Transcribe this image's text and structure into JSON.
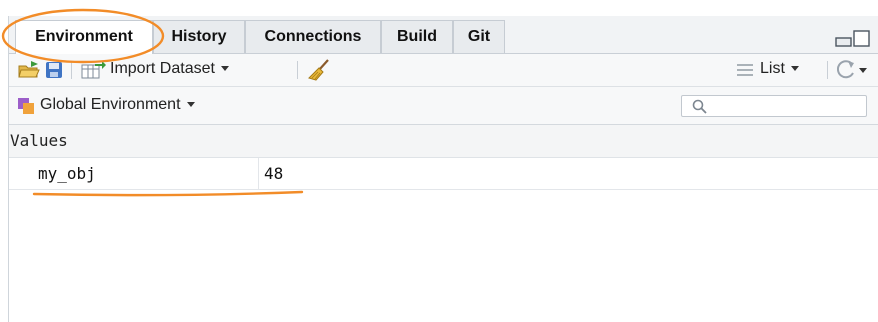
{
  "tabs": [
    {
      "label": "Environment",
      "active": true
    },
    {
      "label": "History",
      "active": false
    },
    {
      "label": "Connections",
      "active": false
    },
    {
      "label": "Build",
      "active": false
    },
    {
      "label": "Git",
      "active": false
    }
  ],
  "toolbar": {
    "import_label": "Import Dataset",
    "view_mode": "List"
  },
  "scope": {
    "label": "Global Environment"
  },
  "search": {
    "placeholder": ""
  },
  "section": {
    "title": "Values"
  },
  "values": [
    {
      "name": "my_obj",
      "value": "48"
    }
  ],
  "colors": {
    "annotation": "#f28c28",
    "accent": "#4a8fd4"
  }
}
